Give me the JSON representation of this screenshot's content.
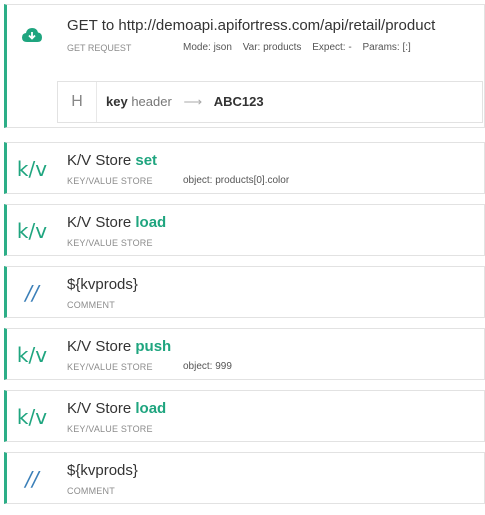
{
  "request": {
    "title": "GET to http://demoapi.apifortress.com/api/retail/product",
    "type_label": "GET REQUEST",
    "mode": "Mode: json",
    "var": "Var: products",
    "expect": "Expect: -",
    "params": "Params: [:]",
    "header": {
      "badge": "H",
      "key": "key",
      "key_type": "header",
      "arrow": "⟶",
      "value": "ABC123"
    }
  },
  "steps": [
    {
      "icon": "k/v",
      "prefix": "K/V Store ",
      "keyword": "set",
      "type_label": "KEY/VALUE STORE",
      "meta": "object: products[0].color"
    },
    {
      "icon": "k/v",
      "prefix": "K/V Store ",
      "keyword": "load",
      "type_label": "KEY/VALUE STORE",
      "meta": ""
    },
    {
      "icon": "//",
      "prefix": "${kvprods}",
      "keyword": "",
      "type_label": "COMMENT",
      "meta": ""
    },
    {
      "icon": "k/v",
      "prefix": "K/V Store ",
      "keyword": "push",
      "type_label": "KEY/VALUE STORE",
      "meta": "object: 999"
    },
    {
      "icon": "k/v",
      "prefix": "K/V Store ",
      "keyword": "load",
      "type_label": "KEY/VALUE STORE",
      "meta": ""
    },
    {
      "icon": "//",
      "prefix": "${kvprods}",
      "keyword": "",
      "type_label": "COMMENT",
      "meta": ""
    }
  ],
  "colors": {
    "accent": "#2cae87",
    "keyword": "#1fa57f",
    "comment_icon": "#3b7fb8"
  }
}
